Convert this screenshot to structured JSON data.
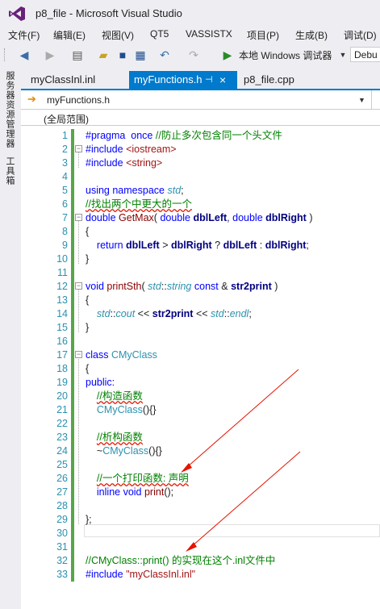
{
  "window": {
    "title": "p8_file - Microsoft Visual Studio"
  },
  "menu": [
    "文件(F)",
    "编辑(E)",
    "视图(V)",
    "QT5",
    "VASSISTX",
    "项目(P)",
    "生成(B)",
    "调试(D)"
  ],
  "toolbar": {
    "run_label": "本地 Windows 调试器",
    "config_value": "Debu"
  },
  "side_tabs": [
    "服务器资源管理器",
    "工具箱"
  ],
  "tabs": [
    {
      "label": "myClassInl.inl",
      "active": false
    },
    {
      "label": "myFunctions.h",
      "active": true,
      "pin": "⊣",
      "close": "×"
    },
    {
      "label": "p8_file.cpp",
      "active": false
    }
  ],
  "nav": {
    "file": "myFunctions.h",
    "scope": "(全局范围)"
  },
  "line_numbers": [
    "1",
    "2",
    "3",
    "4",
    "5",
    "6",
    "7",
    "8",
    "9",
    "10",
    "11",
    "12",
    "13",
    "14",
    "15",
    "16",
    "17",
    "18",
    "19",
    "20",
    "21",
    "22",
    "23",
    "24",
    "25",
    "26",
    "27",
    "28",
    "29",
    "30",
    "31",
    "32",
    "33"
  ],
  "code": {
    "l1a": "#pragma  once",
    "l1b": "//防止多次包含同一个头文件",
    "l2a": "#include",
    "l2b": "<iostream>",
    "l3a": "#include",
    "l3b": "<string>",
    "l5a": "using namespace",
    "l5b": "std",
    "l5c": ";",
    "l6": "//找出两个中更大的一个",
    "l7a": "double",
    "l7b": "GetMax",
    "l7c": "(",
    "l7d": "double",
    "l7e": "dblLeft",
    "l7f": ",",
    "l7g": "double",
    "l7h": "dblRight",
    "l7i": ")",
    "l8": "{",
    "l9a": "return",
    "l9b": "dblLeft",
    "l9c": ">",
    "l9d": "dblRight",
    "l9e": "?",
    "l9f": "dblLeft",
    "l9g": ":",
    "l9h": "dblRight",
    "l9i": ";",
    "l10": "}",
    "l12a": "void",
    "l12b": "printSth",
    "l12c": "(",
    "l12d": "std",
    "l12e": "::",
    "l12f": "string",
    "l12g": "const",
    "l12h": "&",
    "l12i": "str2print",
    "l12j": ")",
    "l13": "{",
    "l14a": "std",
    "l14b": "::",
    "l14c": "cout",
    "l14d": "<<",
    "l14e": "str2print",
    "l14f": "<<",
    "l14g": "std",
    "l14h": "::",
    "l14i": "endl",
    "l14j": ";",
    "l15": "}",
    "l17a": "class",
    "l17b": "CMyClass",
    "l18": "{",
    "l19": "public:",
    "l20": "//构造函数",
    "l21a": "CMyClass",
    "l21b": "(){}",
    "l23": "//析构函数",
    "l24a": "~",
    "l24b": "CMyClass",
    "l24c": "(){}",
    "l26": "//一个打印函数: 声明",
    "l27a": "inline void",
    "l27b": "print",
    "l27c": "();",
    "l29": "};",
    "l32": "//CMyClass::print() 的实现在这个.inl文件中",
    "l33a": "#include",
    "l33b": "\"myClassInl.inl\""
  }
}
